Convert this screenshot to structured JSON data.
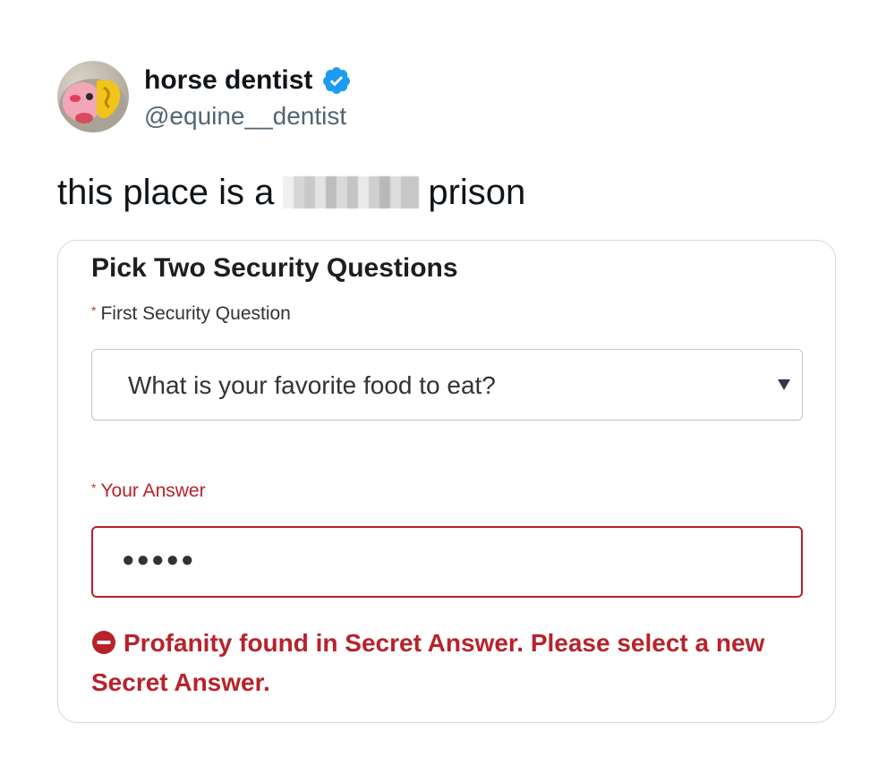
{
  "tweet": {
    "author": {
      "display_name": "horse dentist",
      "handle": "@equine__dentist",
      "verified_icon": "verified-badge-icon",
      "verified_color": "#1d9bf0"
    },
    "text_before": "this place is a",
    "text_after": "prison"
  },
  "form": {
    "title": "Pick Two Security Questions",
    "required_mark": "*",
    "first_question": {
      "label": "First Security Question",
      "selected_value": "What is your favorite food to eat?",
      "chevron_icon": "triangle-down-icon"
    },
    "answer": {
      "label": "Your Answer",
      "value": "●●●●●"
    },
    "error": {
      "icon": "minus-circle-icon",
      "message": "Profanity found in Secret Answer. Please select a new Secret Answer.",
      "color": "#b8222a"
    }
  }
}
